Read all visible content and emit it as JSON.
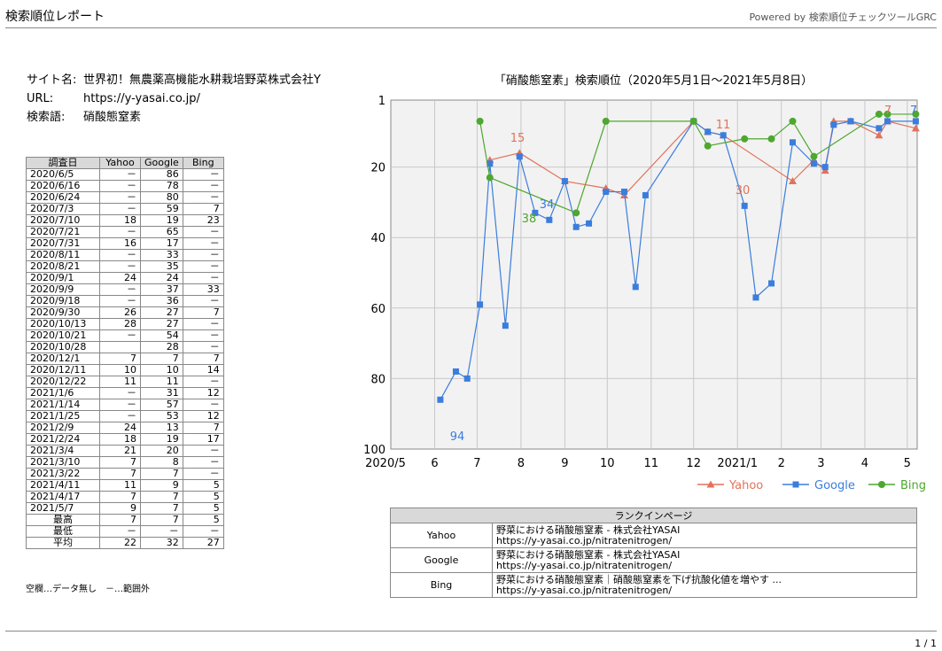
{
  "header": {
    "title": "検索順位レポート",
    "powered": "Powered by 検索順位チェックツールGRC"
  },
  "info": [
    {
      "label": "サイト名:",
      "value": "世界初！無農薬高機能水耕栽培野菜株式会社Y"
    },
    {
      "label": "URL:",
      "value": "https://y-yasai.co.jp/"
    },
    {
      "label": "検索語:",
      "value": "硝酸態窒素"
    }
  ],
  "table": {
    "headers": [
      "調査日",
      "Yahoo",
      "Google",
      "Bing"
    ],
    "rows": [
      [
        "2020/6/5",
        "－",
        "86",
        "－"
      ],
      [
        "2020/6/16",
        "－",
        "78",
        "－"
      ],
      [
        "2020/6/24",
        "－",
        "80",
        "－"
      ],
      [
        "2020/7/3",
        "－",
        "59",
        "7"
      ],
      [
        "2020/7/10",
        "18",
        "19",
        "23"
      ],
      [
        "2020/7/21",
        "－",
        "65",
        "－"
      ],
      [
        "2020/7/31",
        "16",
        "17",
        "－"
      ],
      [
        "2020/8/11",
        "－",
        "33",
        "－"
      ],
      [
        "2020/8/21",
        "－",
        "35",
        "－"
      ],
      [
        "2020/9/1",
        "24",
        "24",
        "－"
      ],
      [
        "2020/9/9",
        "－",
        "37",
        "33"
      ],
      [
        "2020/9/18",
        "－",
        "36",
        "－"
      ],
      [
        "2020/9/30",
        "26",
        "27",
        "7"
      ],
      [
        "2020/10/13",
        "28",
        "27",
        "－"
      ],
      [
        "2020/10/21",
        "－",
        "54",
        "－"
      ],
      [
        "2020/10/28",
        "",
        "28",
        "－"
      ],
      [
        "2020/12/1",
        "7",
        "7",
        "7"
      ],
      [
        "2020/12/11",
        "10",
        "10",
        "14"
      ],
      [
        "2020/12/22",
        "11",
        "11",
        "－"
      ],
      [
        "2021/1/6",
        "－",
        "31",
        "12"
      ],
      [
        "2021/1/14",
        "－",
        "57",
        "－"
      ],
      [
        "2021/1/25",
        "－",
        "53",
        "12"
      ],
      [
        "2021/2/9",
        "24",
        "13",
        "7"
      ],
      [
        "2021/2/24",
        "18",
        "19",
        "17"
      ],
      [
        "2021/3/4",
        "21",
        "20",
        "－"
      ],
      [
        "2021/3/10",
        "7",
        "8",
        "－"
      ],
      [
        "2021/3/22",
        "7",
        "7",
        "－"
      ],
      [
        "2021/4/11",
        "11",
        "9",
        "5"
      ],
      [
        "2021/4/17",
        "7",
        "7",
        "5"
      ],
      [
        "2021/5/7",
        "9",
        "7",
        "5"
      ]
    ],
    "summary": [
      [
        "最高",
        "7",
        "7",
        "5"
      ],
      [
        "最低",
        "－",
        "－",
        "－"
      ],
      [
        "平均",
        "22",
        "32",
        "27"
      ]
    ]
  },
  "note": "空欄…データ無し　－…範囲外",
  "chart_title": "「硝酸態窒素」検索順位（2020年5月1日～2021年5月8日）",
  "chart_data": {
    "type": "line",
    "title": "「硝酸態窒素」検索順位（2020年5月1日～2021年5月8日）",
    "x_range": [
      "2020-05-01",
      "2021-05-08"
    ],
    "x_ticks": [
      "2020/5",
      "6",
      "7",
      "8",
      "9",
      "10",
      "11",
      "12",
      "2021/1",
      "2",
      "3",
      "4",
      "5"
    ],
    "y_ticks": [
      "1",
      "20",
      "40",
      "60",
      "80",
      "100"
    ],
    "y_range": [
      1,
      100
    ],
    "y_inverted": true,
    "legend_position": "bottom-right",
    "series": [
      {
        "name": "Yahoo",
        "color": "#e2725b",
        "marker": "triangle",
        "points": [
          [
            "2020-07-10",
            18
          ],
          [
            "2020-07-31",
            16
          ],
          [
            "2020-09-01",
            24
          ],
          [
            "2020-09-30",
            26
          ],
          [
            "2020-10-13",
            28
          ],
          [
            "2020-12-01",
            7
          ],
          [
            "2020-12-11",
            10
          ],
          [
            "2020-12-22",
            11
          ],
          [
            "2021-02-09",
            24
          ],
          [
            "2021-02-24",
            18
          ],
          [
            "2021-03-04",
            21
          ],
          [
            "2021-03-10",
            7
          ],
          [
            "2021-03-22",
            7
          ],
          [
            "2021-04-11",
            11
          ],
          [
            "2021-04-17",
            7
          ],
          [
            "2021-05-07",
            9
          ]
        ]
      },
      {
        "name": "Google",
        "color": "#3b7ddd",
        "marker": "square",
        "points": [
          [
            "2020-06-05",
            86
          ],
          [
            "2020-06-16",
            78
          ],
          [
            "2020-06-24",
            80
          ],
          [
            "2020-07-03",
            59
          ],
          [
            "2020-07-10",
            19
          ],
          [
            "2020-07-21",
            65
          ],
          [
            "2020-07-31",
            17
          ],
          [
            "2020-08-11",
            33
          ],
          [
            "2020-08-21",
            35
          ],
          [
            "2020-09-01",
            24
          ],
          [
            "2020-09-09",
            37
          ],
          [
            "2020-09-18",
            36
          ],
          [
            "2020-09-30",
            27
          ],
          [
            "2020-10-13",
            27
          ],
          [
            "2020-10-21",
            54
          ],
          [
            "2020-10-28",
            28
          ],
          [
            "2020-12-01",
            7
          ],
          [
            "2020-12-11",
            10
          ],
          [
            "2020-12-22",
            11
          ],
          [
            "2021-01-06",
            31
          ],
          [
            "2021-01-14",
            57
          ],
          [
            "2021-01-25",
            53
          ],
          [
            "2021-02-09",
            13
          ],
          [
            "2021-02-24",
            19
          ],
          [
            "2021-03-04",
            20
          ],
          [
            "2021-03-10",
            8
          ],
          [
            "2021-03-22",
            7
          ],
          [
            "2021-04-11",
            9
          ],
          [
            "2021-04-17",
            7
          ],
          [
            "2021-05-07",
            7
          ]
        ]
      },
      {
        "name": "Bing",
        "color": "#4ea72e",
        "marker": "circle",
        "points": [
          [
            "2020-07-03",
            7
          ],
          [
            "2020-07-10",
            23
          ],
          [
            "2020-09-09",
            33
          ],
          [
            "2020-09-30",
            7
          ],
          [
            "2020-12-01",
            7
          ],
          [
            "2020-12-11",
            14
          ],
          [
            "2021-01-06",
            12
          ],
          [
            "2021-01-25",
            12
          ],
          [
            "2021-02-09",
            7
          ],
          [
            "2021-02-24",
            17
          ],
          [
            "2021-04-11",
            5
          ],
          [
            "2021-04-17",
            5
          ],
          [
            "2021-05-07",
            5
          ]
        ]
      }
    ],
    "annotations": [
      {
        "text": "94",
        "series": "Google"
      },
      {
        "text": "34",
        "series": "Google"
      },
      {
        "text": "15",
        "series": "Yahoo"
      },
      {
        "text": "38",
        "series": "Bing"
      },
      {
        "text": "11",
        "series": "Yahoo"
      },
      {
        "text": "30",
        "series": "Yahoo"
      },
      {
        "text": "7",
        "series": "Yahoo"
      },
      {
        "text": "7",
        "series": "Google"
      }
    ]
  },
  "rank_table": {
    "header": "ランクインページ",
    "rows": [
      {
        "engine": "Yahoo",
        "title": "野菜における硝酸態窒素 - 株式会社YASAI",
        "url": "https://y-yasai.co.jp/nitratenitrogen/"
      },
      {
        "engine": "Google",
        "title": "野菜における硝酸態窒素 - 株式会社YASAI",
        "url": "https://y-yasai.co.jp/nitratenitrogen/"
      },
      {
        "engine": "Bing",
        "title": "野菜における硝酸態窒素｜硝酸態窒素を下げ抗酸化値を増やす ...",
        "url": "https://y-yasai.co.jp/nitratenitrogen/"
      }
    ]
  },
  "footer": {
    "page": "1 / 1"
  }
}
